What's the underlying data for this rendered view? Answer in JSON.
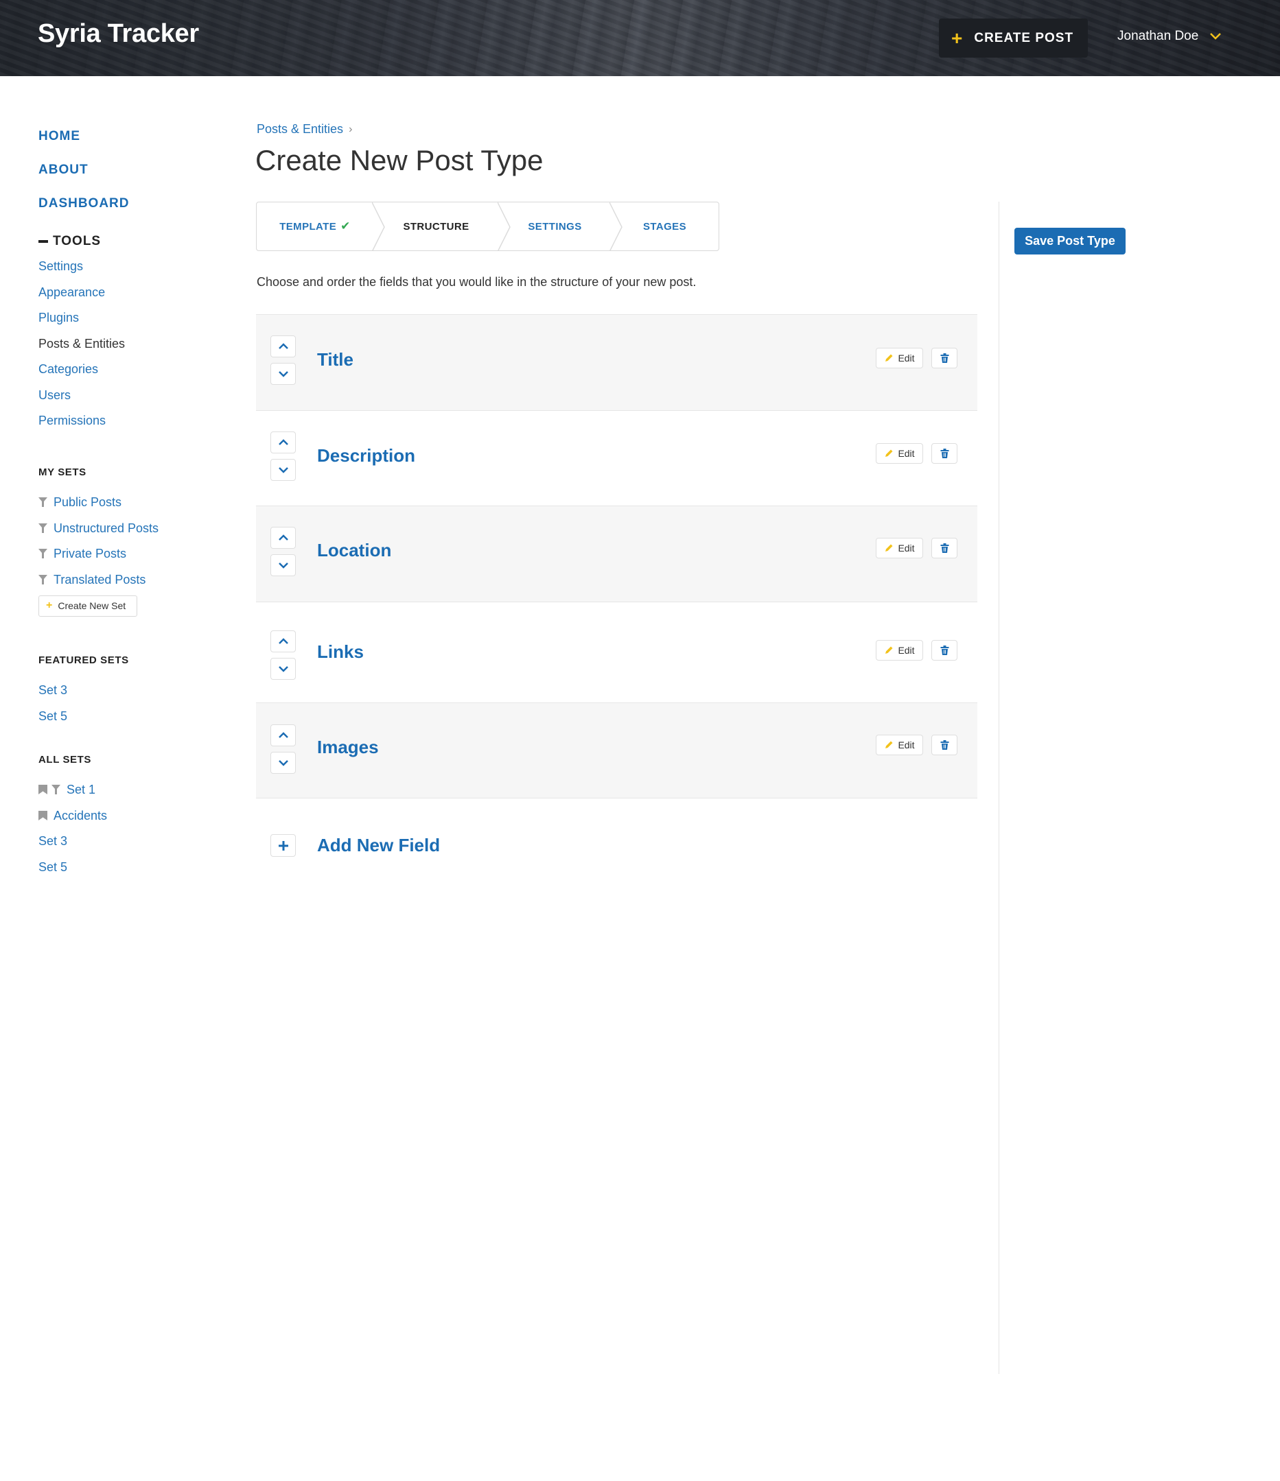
{
  "header": {
    "brand": "Syria Tracker",
    "create_post_label": "CREATE POST",
    "user_name": "Jonathan Doe"
  },
  "sidebar": {
    "main_nav": [
      "HOME",
      "ABOUT",
      "DASHBOARD"
    ],
    "tools_label": "TOOLS",
    "tools_items": [
      "Settings",
      "Appearance",
      "Plugins",
      "Posts & Entities",
      "Categories",
      "Users",
      "Permissions"
    ],
    "tools_active": "Posts & Entities",
    "my_sets": {
      "heading": "MY SETS",
      "items": [
        "Public Posts",
        "Unstructured Posts",
        "Private Posts",
        "Translated Posts"
      ],
      "create_label": "Create New Set"
    },
    "featured_sets": {
      "heading": "FEATURED SETS",
      "items": [
        "Set 3",
        "Set 5"
      ]
    },
    "all_sets": {
      "heading": "ALL SETS",
      "items": [
        {
          "label": "Set 1",
          "icons": [
            "bookmark-icon",
            "filter-icon"
          ]
        },
        {
          "label": "Accidents",
          "icons": [
            "bookmark-icon"
          ]
        },
        {
          "label": "Set 3",
          "icons": []
        },
        {
          "label": "Set 5",
          "icons": []
        }
      ]
    }
  },
  "main": {
    "breadcrumb": "Posts & Entities",
    "title": "Create New Post Type",
    "steps": [
      {
        "label": "TEMPLATE",
        "state": "done"
      },
      {
        "label": "STRUCTURE",
        "state": "current"
      },
      {
        "label": "SETTINGS",
        "state": "upcoming"
      },
      {
        "label": "STAGES",
        "state": "upcoming"
      }
    ],
    "intro": "Choose and order the fields that you would like in the structure of your new post.",
    "fields": [
      "Title",
      "Description",
      "Location",
      "Links",
      "Images"
    ],
    "edit_label": "Edit",
    "add_field_label": "Add New Field"
  },
  "aside": {
    "save_label": "Save Post Type"
  },
  "colors": {
    "accent_blue": "#1b6cb3",
    "link_blue": "#2574b8",
    "yellow": "#f2c21b",
    "success_green": "#33a852",
    "row_shade": "#f6f6f6"
  }
}
